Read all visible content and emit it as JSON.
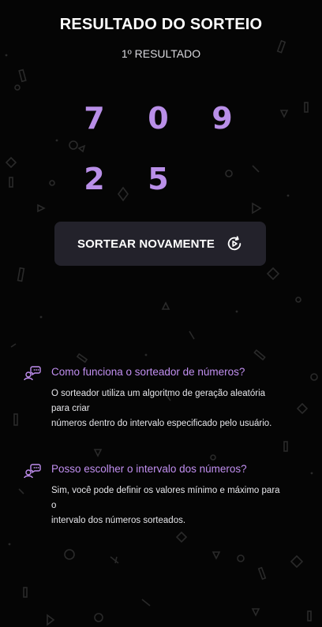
{
  "header": {
    "title": "RESULTADO DO SORTEIO",
    "subtitle": "1º RESULTADO"
  },
  "results": {
    "numbers": [
      "7",
      "0",
      "9",
      "2",
      "5"
    ]
  },
  "actions": {
    "redraw_label": "SORTEAR NOVAMENTE",
    "redraw_icon": "refresh-play-icon"
  },
  "faq": [
    {
      "icon": "chat-person-icon",
      "question": "Como funciona o sorteador de números?",
      "answer_lines": [
        "O sorteador utiliza um algoritmo de geração aleatória",
        "para criar",
        "números dentro do intervalo especificado pelo usuário."
      ]
    },
    {
      "icon": "chat-person-icon",
      "question": "Posso escolher o intervalo dos números?",
      "answer_lines": [
        "Sim, você pode definir os valores mínimo e máximo para",
        "o",
        "intervalo dos números sorteados."
      ]
    }
  ],
  "colors": {
    "background": "#050505",
    "accent": "#b98fe8",
    "button_bg": "#23222b",
    "question_text": "#c18ff0"
  }
}
